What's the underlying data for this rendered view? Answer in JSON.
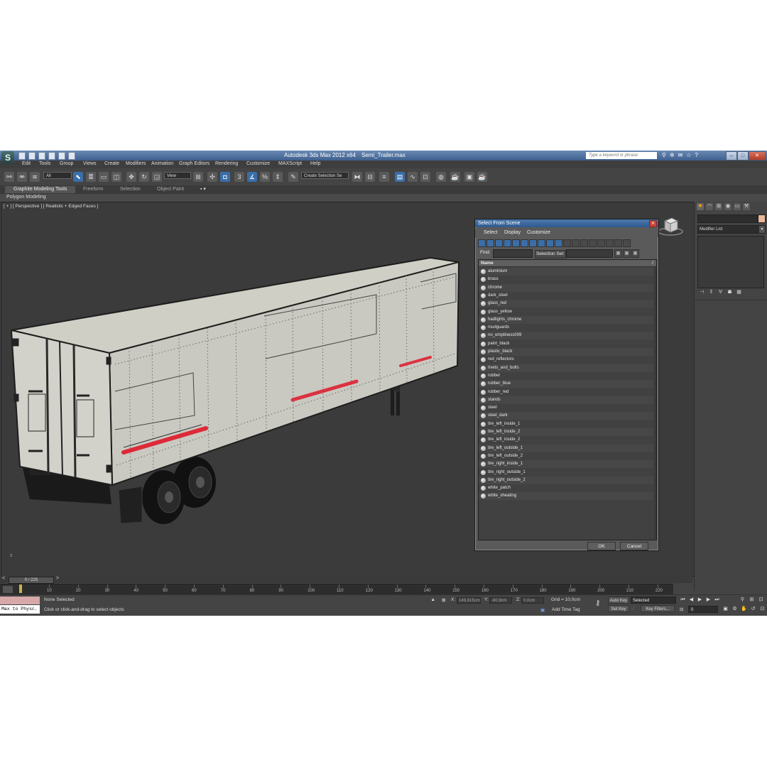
{
  "title": {
    "app": "Autodesk 3ds Max  2012 x64",
    "file": "Semi_Trailer.max"
  },
  "search": {
    "placeholder": "Type a keyword or phrase"
  },
  "menu": [
    "Edit",
    "Tools",
    "Group",
    "Views",
    "Create",
    "Modifiers",
    "Animation",
    "Graph Editors",
    "Rendering",
    "Customize",
    "MAXScript",
    "Help"
  ],
  "toolbar": {
    "selection_filter": "All",
    "reference_coord": "View",
    "named_selection": "Create Selection Se"
  },
  "ribbon": {
    "tabs": [
      "Graphite Modeling Tools",
      "Freeform",
      "Selection",
      "Object Paint"
    ],
    "active_tab": "Graphite Modeling Tools",
    "sub_label": "Polygon Modeling"
  },
  "viewport": {
    "label": "[ + ] [ Perspective ] [ Realistic + Edged Faces ]",
    "axis_label": "z"
  },
  "command_panel": {
    "modifier_list": "Modifier List"
  },
  "dialog": {
    "title": "Select From Scene",
    "menu": [
      "Select",
      "Display",
      "Customize"
    ],
    "find_label": "Find:",
    "selection_set_label": "Selection Set:",
    "column_header": "Name",
    "sort_indicator": "/",
    "items": [
      "aluminium",
      "brass",
      "chrome",
      "dark_steel",
      "glass_red",
      "glass_yellow",
      "hadlights_chrome",
      "mudguards",
      "no_emptiness009",
      "paint_black",
      "plastic_black",
      "red_reflectors",
      "rivets_and_bolts",
      "rubber",
      "rubber_blue",
      "rubber_red",
      "stands",
      "steel",
      "steel_dark",
      "tire_left_inside_1",
      "tire_left_inside_2",
      "tire_left_inside_2",
      "tire_left_outside_1",
      "tire_left_outside_2",
      "tire_right_inside_1",
      "tire_right_outside_1",
      "tire_right_outside_2",
      "white_patch",
      "white_sheating"
    ],
    "ok_label": "OK",
    "cancel_label": "Cancel"
  },
  "timeline": {
    "slider_label": "0 / 225",
    "ticks": [
      "10",
      "20",
      "30",
      "40",
      "50",
      "60",
      "70",
      "80",
      "90",
      "100",
      "110",
      "120",
      "130",
      "140",
      "150",
      "160",
      "170",
      "180",
      "190",
      "200",
      "210",
      "220"
    ]
  },
  "status": {
    "maxscript_line": "Max to Physc.",
    "selection_info": "None Selected",
    "prompt": "Click or click-and-drag to select objects",
    "x_label": "X:",
    "x_value": "149,915cm",
    "y_label": "Y:",
    "y_value": "-60,9cm",
    "z_label": "Z:",
    "z_value": "0,0cm",
    "grid": "Grid = 10,0cm",
    "add_time_tag": "Add Time Tag",
    "auto_key": "Auto Key",
    "set_key": "Set Key",
    "key_mode": "Selected",
    "key_filters": "Key Filters...",
    "frame": "0"
  },
  "colors": {
    "accent": "#3a6ea8",
    "title_bar": "#4b78ae",
    "viewport_bg": "#3b3b3b",
    "stripe": "#e0182a"
  }
}
